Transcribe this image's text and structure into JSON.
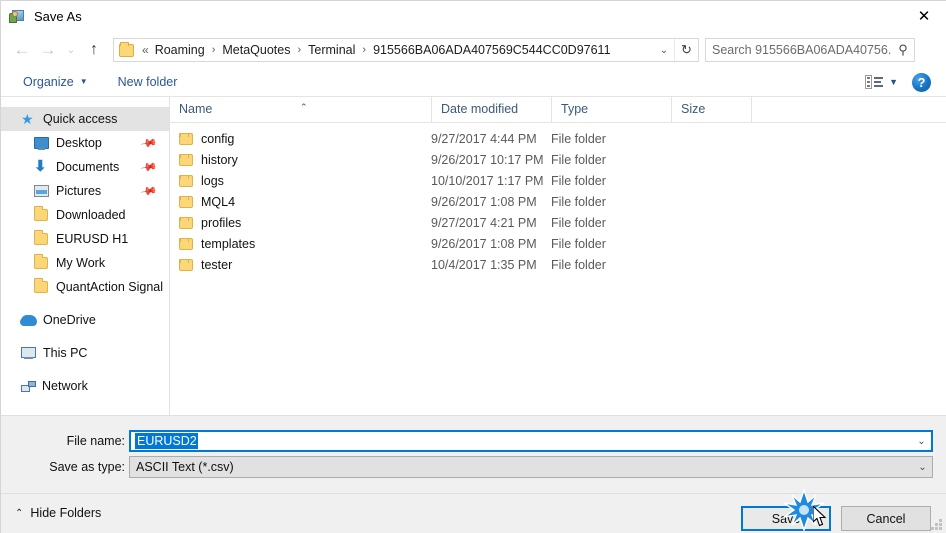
{
  "window": {
    "title": "Save As",
    "icon": "save-as-app-icon",
    "close_label": "✕"
  },
  "nav": {
    "back": "←",
    "forward": "→",
    "recent": "⌄",
    "up": "↑",
    "refresh": "↻",
    "dropdown": "⌄",
    "breadcrumb_prefix": "«",
    "breadcrumb_separator": "›",
    "breadcrumbs": [
      "Roaming",
      "MetaQuotes",
      "Terminal",
      "915566BA06ADA407569C544CC0D97611"
    ]
  },
  "search": {
    "placeholder": "Search 915566BA06ADA40756...",
    "icon": "⚲"
  },
  "toolbar": {
    "organize_label": "Organize",
    "organize_caret": "▼",
    "new_folder_label": "New folder",
    "view_caret": "▼",
    "help_label": "?"
  },
  "sidebar": {
    "items": [
      {
        "label": "Quick access",
        "icon": "star-pin-icon",
        "level": "root",
        "selected": true,
        "pinned": false
      },
      {
        "label": "Desktop",
        "icon": "desktop-icon",
        "level": "child",
        "selected": false,
        "pinned": true
      },
      {
        "label": "Documents",
        "icon": "documents-icon",
        "level": "child",
        "selected": false,
        "pinned": true
      },
      {
        "label": "Pictures",
        "icon": "pictures-icon",
        "level": "child",
        "selected": false,
        "pinned": true
      },
      {
        "label": "Downloaded",
        "icon": "folder-icon",
        "level": "child",
        "selected": false,
        "pinned": false
      },
      {
        "label": "EURUSD H1",
        "icon": "folder-icon",
        "level": "child",
        "selected": false,
        "pinned": false
      },
      {
        "label": "My Work",
        "icon": "folder-icon",
        "level": "child",
        "selected": false,
        "pinned": false
      },
      {
        "label": "QuantAction Signal",
        "icon": "folder-icon",
        "level": "child",
        "selected": false,
        "pinned": false
      },
      {
        "label": "OneDrive",
        "icon": "onedrive-icon",
        "level": "root",
        "selected": false,
        "pinned": false,
        "gap_before": true
      },
      {
        "label": "This PC",
        "icon": "this-pc-icon",
        "level": "root",
        "selected": false,
        "pinned": false,
        "gap_before": true
      },
      {
        "label": "Network",
        "icon": "network-icon",
        "level": "root",
        "selected": false,
        "pinned": false,
        "gap_before": true
      }
    ]
  },
  "filelist": {
    "columns": [
      "Name",
      "Date modified",
      "Type",
      "Size"
    ],
    "sort_column": "Name",
    "sort_caret": "⌃",
    "rows": [
      {
        "name": "config",
        "date": "9/27/2017 4:44 PM",
        "type": "File folder",
        "size": ""
      },
      {
        "name": "history",
        "date": "9/26/2017 10:17 PM",
        "type": "File folder",
        "size": ""
      },
      {
        "name": "logs",
        "date": "10/10/2017 1:17 PM",
        "type": "File folder",
        "size": ""
      },
      {
        "name": "MQL4",
        "date": "9/26/2017 1:08 PM",
        "type": "File folder",
        "size": ""
      },
      {
        "name": "profiles",
        "date": "9/27/2017 4:21 PM",
        "type": "File folder",
        "size": ""
      },
      {
        "name": "templates",
        "date": "9/26/2017 1:08 PM",
        "type": "File folder",
        "size": ""
      },
      {
        "name": "tester",
        "date": "10/4/2017 1:35 PM",
        "type": "File folder",
        "size": ""
      }
    ]
  },
  "form": {
    "filename_label": "File name:",
    "filename_value": "EURUSD2",
    "filename_selected": true,
    "savetype_label": "Save as type:",
    "savetype_value": "ASCII Text (*.csv)",
    "dropdown_caret": "⌄"
  },
  "footer": {
    "hide_folders_label": "Hide Folders",
    "hide_folders_caret": "⌃",
    "save_label": "Save",
    "cancel_label": "Cancel"
  },
  "colors": {
    "accent": "#0078d7",
    "toolbar_link": "#2b5797",
    "folder_yellow": "#fcd77a",
    "column_header_text": "#3c5a77",
    "sidebar_selection": "#e3e3e3",
    "chrome_gray": "#f0f0f0"
  }
}
